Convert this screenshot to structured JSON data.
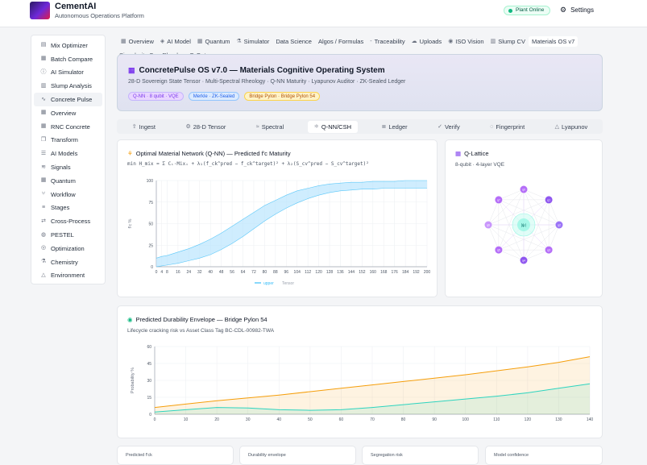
{
  "header": {
    "brand": "CementAI",
    "subtitle": "Autonomous Operations Platform",
    "status": "Plant Online",
    "settings": "Settings"
  },
  "sidebar": {
    "items": [
      {
        "label": "Mix Optimizer",
        "icon": "clipboard-icon"
      },
      {
        "label": "Batch Compare",
        "icon": "grid-icon"
      },
      {
        "label": "AI Simulator",
        "icon": "info-icon"
      },
      {
        "label": "Slump Analysis",
        "icon": "chart-icon"
      },
      {
        "label": "Concrete Pulse",
        "icon": "pulse-icon",
        "active": true
      },
      {
        "label": "Overview",
        "icon": "grid-icon"
      },
      {
        "label": "RNC Concrete",
        "icon": "grid-icon"
      },
      {
        "label": "Transform",
        "icon": "copy-icon"
      },
      {
        "label": "AI Models",
        "icon": "list-icon"
      },
      {
        "label": "Signals",
        "icon": "signal-icon"
      },
      {
        "label": "Quantum",
        "icon": "grid-icon"
      },
      {
        "label": "Workflow",
        "icon": "workflow-icon"
      },
      {
        "label": "Stages",
        "icon": "layers-icon"
      },
      {
        "label": "Cross-Process",
        "icon": "shuffle-icon"
      },
      {
        "label": "PESTEL",
        "icon": "globe-icon"
      },
      {
        "label": "Optimization",
        "icon": "target-icon"
      },
      {
        "label": "Chemistry",
        "icon": "flask-icon"
      },
      {
        "label": "Environment",
        "icon": "triangle-icon"
      }
    ]
  },
  "tabs": [
    {
      "label": "Overview",
      "icon": "grid-icon"
    },
    {
      "label": "AI Model",
      "icon": "brain-icon"
    },
    {
      "label": "Quantum",
      "icon": "grid-icon"
    },
    {
      "label": "Simulator",
      "icon": "flask-icon"
    },
    {
      "label": "Data Science",
      "icon": ""
    },
    {
      "label": "Algos / Formulas",
      "icon": ""
    },
    {
      "label": "Traceability",
      "icon": "dash-icon"
    },
    {
      "label": "Uploads",
      "icon": "cloud-icon"
    },
    {
      "label": "ISO Vision",
      "icon": "eye-icon"
    },
    {
      "label": "Slump CV",
      "icon": "chart-icon"
    },
    {
      "label": "Materials OS v7",
      "icon": "",
      "active": true
    }
  ],
  "breadcrumb": "Singularity CoreRheology Q-Opt",
  "hero": {
    "title": "ConcretePulse OS v7.0 — Materials Cognitive Operating System",
    "subtitle": "28-D Sovereign State Tensor · Multi-Spectral Rheology · Q-NN Maturity · Lyapunov Auditor · ZK-Sealed Ledger",
    "pills": [
      "Q-NN · 8 qubit · VQE",
      "Merkle · ZK-Sealed",
      "Bridge Pylon · Bridge Pylon 54"
    ]
  },
  "subtabs": [
    {
      "label": "Ingest",
      "icon": "upload-icon"
    },
    {
      "label": "28-D Tensor",
      "icon": "gear-icon"
    },
    {
      "label": "Spectral",
      "icon": "wave-icon"
    },
    {
      "label": "Q-NN/CSH",
      "icon": "atom-icon",
      "active": true
    },
    {
      "label": "Ledger",
      "icon": "ledger-icon"
    },
    {
      "label": "Verify",
      "icon": "check-icon"
    },
    {
      "label": "Fingerprint",
      "icon": "fingerprint-icon"
    },
    {
      "label": "Lyapunov",
      "icon": "triangle-icon"
    }
  ],
  "maturity_card": {
    "title": "Optimal Material Network (Q-NN) — Predicted f'c Maturity",
    "formula": "min H_mix = Σ Cᵢ·Mixᵢ + λ₁(f_ck^pred − f_ck^target)² + λ₂(S_cv^pred − S_cv^target)²",
    "chart_data": {
      "type": "area",
      "x": [
        0,
        4,
        8,
        16,
        24,
        32,
        40,
        48,
        56,
        64,
        72,
        80,
        88,
        96,
        104,
        112,
        120,
        128,
        136,
        144,
        152,
        160,
        168,
        176,
        184,
        192,
        200
      ],
      "tick_labels": [
        "0",
        "4",
        "8",
        "16",
        "24",
        "32",
        "40",
        "48",
        "56",
        "64",
        "72",
        "80",
        "88",
        "96",
        "104",
        "112",
        "120",
        "128",
        "136",
        "144",
        "152",
        "160",
        "168",
        "176",
        "184",
        "192",
        "200"
      ],
      "ylabel": "f'c %",
      "ylim": [
        0,
        100
      ],
      "y_ticks": [
        0,
        25,
        50,
        75,
        100
      ],
      "series": [
        {
          "name": "upper",
          "values": [
            10,
            12,
            13,
            17,
            21,
            26,
            32,
            39,
            47,
            55,
            63,
            71,
            77,
            83,
            88,
            91,
            94,
            96,
            97,
            98,
            98,
            99,
            99,
            99,
            100,
            100,
            100
          ]
        },
        {
          "name": "lower",
          "values": [
            0,
            1,
            2,
            4,
            7,
            10,
            14,
            20,
            27,
            35,
            44,
            53,
            61,
            68,
            74,
            79,
            83,
            86,
            88,
            89,
            90,
            90,
            91,
            91,
            91,
            91,
            91
          ]
        }
      ],
      "legend": [
        "upper",
        "Tensor"
      ],
      "series_color": "#38bdf8"
    }
  },
  "lattice_card": {
    "title": "Q-Lattice",
    "subtitle": "8-qubit · 4-layer VQE",
    "center_label": "|ψ⟩",
    "nodes": [
      "q0",
      "q1",
      "q2",
      "q3",
      "q4",
      "q5",
      "q6",
      "q7"
    ],
    "node_colors": [
      "#a855f7",
      "#7c3aed",
      "#8b5cf6",
      "#a855f7",
      "#7c3aed",
      "#a855f7",
      "#c084fc",
      "#a855f7"
    ]
  },
  "durability_card": {
    "title": "Predicted Durability Envelope — Bridge Pylon 54",
    "subtitle": "Lifecycle cracking risk vs Asset Class Tag BC-CDL-00982-TWA",
    "chart_data": {
      "type": "area",
      "x": [
        0,
        10,
        20,
        30,
        40,
        50,
        60,
        70,
        80,
        90,
        100,
        110,
        120,
        130,
        140
      ],
      "tick_labels": [
        "0",
        "10",
        "20",
        "30",
        "40",
        "50",
        "60",
        "70",
        "80",
        "90",
        "100",
        "110",
        "120",
        "130",
        "140"
      ],
      "ylabel": "Probability %",
      "ylim": [
        0,
        60
      ],
      "y_ticks": [
        0,
        15,
        30,
        45,
        60
      ],
      "series": [
        {
          "name": "cracking",
          "values": [
            6,
            9,
            12,
            14.5,
            17,
            20,
            23,
            26,
            29,
            32,
            35,
            38.5,
            42,
            46,
            51
          ],
          "color": "#f59e0b"
        },
        {
          "name": "chloride",
          "values": [
            2,
            4,
            6,
            5.5,
            4,
            3.5,
            4,
            6,
            8.5,
            11,
            13.5,
            16,
            19,
            23,
            27
          ],
          "color": "#2dd4bf"
        }
      ]
    }
  },
  "kpis": [
    "Predicted f'ck",
    "Durability envelope",
    "Segregation risk",
    "Model confidence"
  ]
}
